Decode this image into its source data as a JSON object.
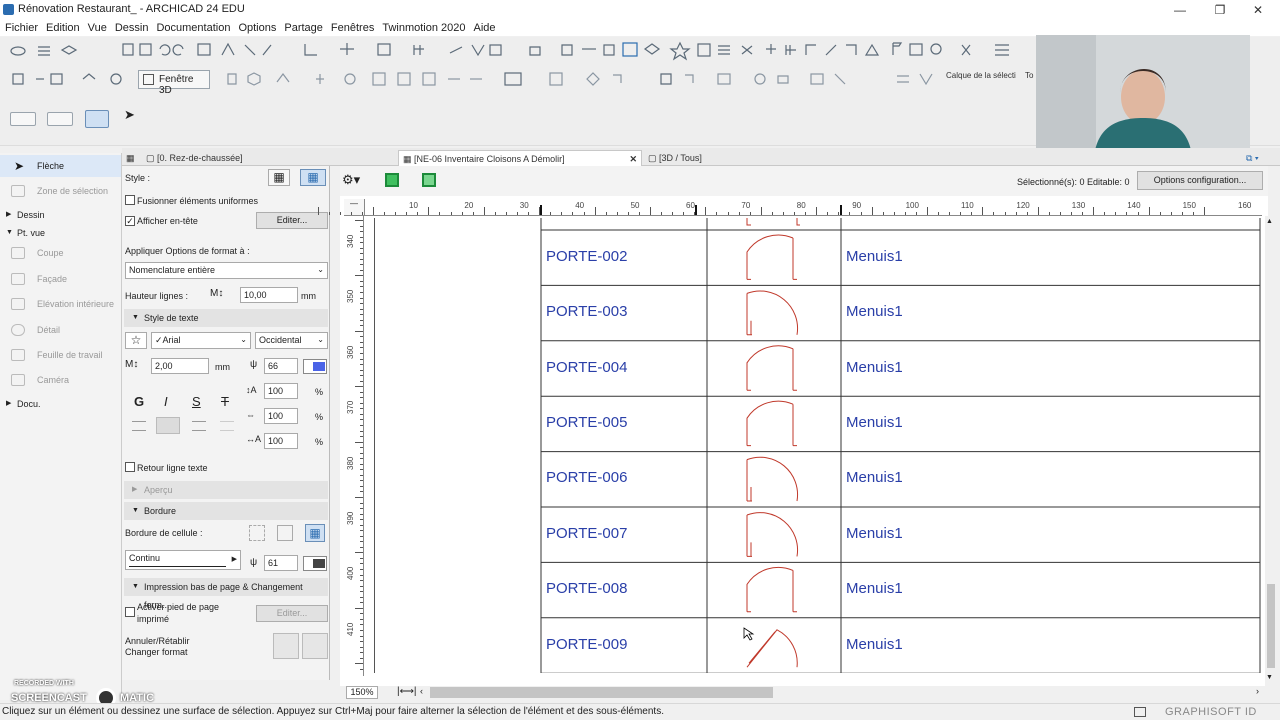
{
  "window": {
    "title": "Rénovation Restaurant_ - ARCHICAD 24 EDU",
    "minimize": "—",
    "restore": "❐",
    "close": "✕"
  },
  "menu": [
    "Fichier",
    "Edition",
    "Vue",
    "Dessin",
    "Documentation",
    "Options",
    "Partage",
    "Fenêtres",
    "Twinmotion 2020",
    "Aide"
  ],
  "toolbar2": {
    "fenetre3d_label": "Fenêtre 3D",
    "layer_label": "Calque de la sélecti",
    "layer_label2": "To"
  },
  "tabs": {
    "floor": "[0. Rez-de-chaussée]",
    "schedule": "[NE-06 Inventaire Cloisons A Démolir]",
    "schedule_close": "✕",
    "view3d": "[3D / Tous]"
  },
  "toolbox": {
    "arrow": "Flèche",
    "marquee": "Zone de sélection",
    "group_dessin": "Dessin",
    "group_ptvue": "Pt. vue",
    "items": [
      "Coupe",
      "Façade",
      "Elévation intérieure",
      "Détail",
      "Feuille de travail",
      "Caméra"
    ],
    "group_docu": "Docu."
  },
  "panel": {
    "style_label": "Style :",
    "merge_label": "Fusionner éléments uniformes",
    "merge_checked": false,
    "header_label": "Afficher en-tête",
    "header_checked": true,
    "edit_button": "Editer...",
    "apply_format_label": "Appliquer Options de format à :",
    "apply_format_value": "Nomenclature entière",
    "row_height_label": "Hauteur lignes :",
    "row_height_value": "10,00",
    "row_height_unit": "mm",
    "text_style_section": "Style de texte",
    "font_value": "✓Arial",
    "script_value": "Occidental",
    "font_size_value": "2,00",
    "font_size_unit": "mm",
    "pen_value": "66",
    "bold": "G",
    "italic": "I",
    "underline": "S",
    "strike": "T",
    "spacing1": "100",
    "spacing2": "100",
    "spacing3": "100",
    "percent": "%",
    "wrap_label": "Retour ligne texte",
    "wrap_checked": false,
    "preview_section": "Aperçu",
    "border_section": "Bordure",
    "cell_border_label": "Bordure de cellule :",
    "line_type_value": "Continu",
    "border_pen_value": "61",
    "footer_section": "Impression bas de page & Changement form...",
    "footer_label_1": "Activer pied de page",
    "footer_label_2": "imprimé",
    "footer_checked": false,
    "footer_edit_button": "Editer...",
    "undo_label_1": "Annuler/Rétablir",
    "undo_label_2": "Changer format"
  },
  "workspace": {
    "selection_status": "Sélectionné(s): 0   Editable: 0",
    "options_button": "Options configuration...",
    "zoom": "150%",
    "ruler_h": [
      "10",
      "20",
      "30",
      "40",
      "50",
      "60",
      "70",
      "80",
      "90",
      "100",
      "110",
      "120",
      "130",
      "140",
      "150",
      "160"
    ],
    "ruler_v": [
      "340",
      "350",
      "360",
      "370",
      "380",
      "390",
      "400",
      "410"
    ]
  },
  "schedule_rows": [
    {
      "id": "PORTE-002",
      "material": "Menuis1",
      "hinge": "right"
    },
    {
      "id": "PORTE-003",
      "material": "Menuis1",
      "hinge": "left"
    },
    {
      "id": "PORTE-004",
      "material": "Menuis1",
      "hinge": "right"
    },
    {
      "id": "PORTE-005",
      "material": "Menuis1",
      "hinge": "right"
    },
    {
      "id": "PORTE-006",
      "material": "Menuis1",
      "hinge": "left"
    },
    {
      "id": "PORTE-007",
      "material": "Menuis1",
      "hinge": "left"
    },
    {
      "id": "PORTE-008",
      "material": "Menuis1",
      "hinge": "right"
    },
    {
      "id": "PORTE-009",
      "material": "Menuis1",
      "hinge": "angled"
    }
  ],
  "status_bar": {
    "text": "Cliquez sur un élément ou dessinez une surface de sélection. Appuyez sur Ctrl+Maj pour faire alterner la sélection de l'élément et des sous-éléments.",
    "brand": "GRAPHISOFT ID"
  },
  "watermark": {
    "line1": "RECORDED WITH",
    "line2": "SCREENCAST",
    "line3": "MATIC"
  },
  "colors": {
    "schedule_text": "#2a3fa8",
    "door_symbol": "#c0392b",
    "selected_tool": "#dce8f7"
  }
}
